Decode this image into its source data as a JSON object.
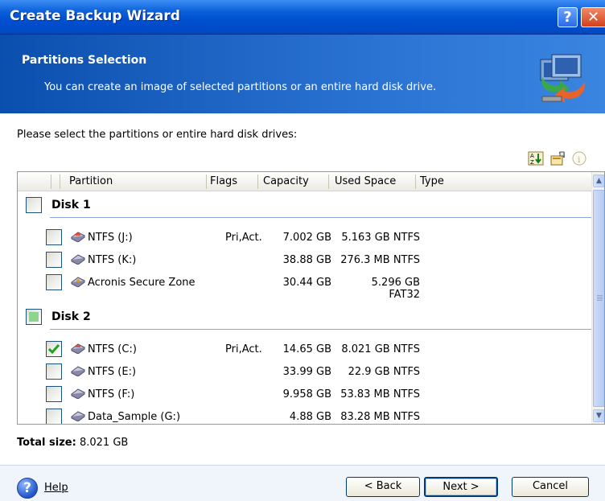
{
  "window": {
    "title": "Create Backup Wizard"
  },
  "header": {
    "title": "Partitions Selection",
    "subtitle": "You can create an image of selected partitions or an entire hard disk drive."
  },
  "instruction": "Please select the partitions or entire hard disk drives:",
  "columns": [
    "Partition",
    "Flags",
    "Capacity",
    "Used Space",
    "Type"
  ],
  "disks": [
    {
      "name": "Disk 1",
      "partitions": [
        {
          "name": "NTFS (J:)",
          "flags": "Pri,Act.",
          "capacity": "7.002 GB",
          "used": "5.163 GB",
          "type": "NTFS"
        },
        {
          "name": "NTFS (K:)",
          "flags": "",
          "capacity": "38.88 GB",
          "used": "276.3 MB",
          "type": "NTFS"
        },
        {
          "name": "Acronis Secure Zone",
          "flags": "",
          "capacity": "30.44 GB",
          "used": "5.296 GB",
          "type": "FAT32"
        }
      ]
    },
    {
      "name": "Disk 2",
      "partitions": [
        {
          "name": "NTFS (C:)",
          "flags": "Pri,Act.",
          "capacity": "14.65 GB",
          "used": "8.021 GB",
          "type": "NTFS"
        },
        {
          "name": "NTFS (E:)",
          "flags": "",
          "capacity": "33.99 GB",
          "used": "22.9 GB",
          "type": "NTFS"
        },
        {
          "name": "NTFS (F:)",
          "flags": "",
          "capacity": "9.958 GB",
          "used": "53.83 MB",
          "type": "NTFS"
        },
        {
          "name": "Data_Sample (G:)",
          "flags": "",
          "capacity": "4.88 GB",
          "used": "83.28 MB",
          "type": "NTFS"
        }
      ]
    }
  ],
  "total": {
    "label": "Total size:",
    "value": "8.021 GB"
  },
  "buttons": {
    "help": "Help",
    "back": "< Back",
    "next": "Next >",
    "cancel": "Cancel"
  },
  "icons": [
    "help-titlebar-icon",
    "close-icon",
    "backup-wizard-logo-icon",
    "sort-icon",
    "properties-icon",
    "info-icon",
    "partition-icon",
    "help-icon"
  ]
}
